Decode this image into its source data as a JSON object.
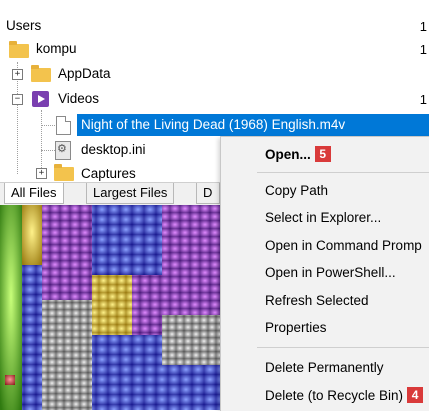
{
  "tree": {
    "root": {
      "label": "Users",
      "trailing": "1"
    },
    "kompu": {
      "label": "kompu",
      "trailing": "1"
    },
    "appdata": {
      "label": "AppData",
      "expander": "+",
      "trailing": ""
    },
    "videos": {
      "label": "Videos",
      "expander": "−",
      "trailing": "1"
    },
    "selected_file": {
      "label": "Night of the Living Dead (1968) English.m4v"
    },
    "desktop_ini": {
      "label": "desktop.ini"
    },
    "captures": {
      "label": "Captures",
      "expander": "+"
    }
  },
  "tabs": [
    {
      "label": "All Files",
      "active": true
    },
    {
      "label": "Largest Files",
      "active": false
    },
    {
      "label": "D",
      "active": false
    }
  ],
  "context_menu": {
    "items": [
      {
        "label": "Open...",
        "bold": true,
        "badge": "5"
      },
      {
        "label": "Copy Path"
      },
      {
        "label": "Select in Explorer..."
      },
      {
        "label": "Open in Command Promp"
      },
      {
        "label": "Open in PowerShell..."
      },
      {
        "label": "Refresh Selected"
      },
      {
        "label": "Properties"
      },
      {
        "label": "Delete Permanently"
      },
      {
        "label": "Delete (to Recycle Bin)",
        "badge": "4"
      }
    ]
  },
  "colors": {
    "selection": "#0078d7",
    "badge": "#d93a3a",
    "folder": "#f3c34d",
    "video_icon": "#7a3fb0"
  }
}
